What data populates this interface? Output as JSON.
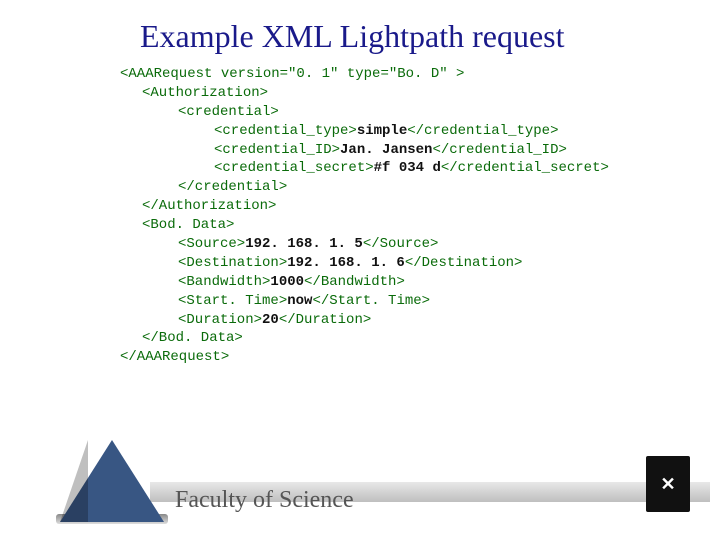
{
  "title": "Example XML Lightpath request",
  "xml": {
    "root_open": "<AAARequest version=\"0. 1\" type=\"Bo. D\" >",
    "auth_open": "<Authorization>",
    "cred_open": "<credential>",
    "cred_type_open": "<credential_type>",
    "cred_type_val": "simple",
    "cred_type_close": "</credential_type>",
    "cred_id_open": "<credential_ID>",
    "cred_id_val": "Jan. Jansen",
    "cred_id_close": "</credential_ID>",
    "cred_sec_open": "<credential_secret>",
    "cred_sec_val": "#f 034 d",
    "cred_sec_close": "</credential_secret>",
    "cred_close": "</credential>",
    "auth_close": "</Authorization>",
    "bod_open": "<Bod. Data>",
    "src_open": "<Source>",
    "src_val": "192. 168. 1. 5",
    "src_close": "</Source>",
    "dst_open": "<Destination>",
    "dst_val": "192. 168. 1. 6",
    "dst_close": "</Destination>",
    "bw_open": "<Bandwidth>",
    "bw_val": "1000",
    "bw_close": "</Bandwidth>",
    "st_open": "<Start. Time>",
    "st_val": "now",
    "st_close": "</Start. Time>",
    "dur_open": "<Duration>",
    "dur_val": "20",
    "dur_close": "</Duration>",
    "bod_close": "</Bod. Data>",
    "root_close": "</AAARequest>"
  },
  "footer": {
    "text": "Faculty of Science",
    "crest": "✕"
  }
}
